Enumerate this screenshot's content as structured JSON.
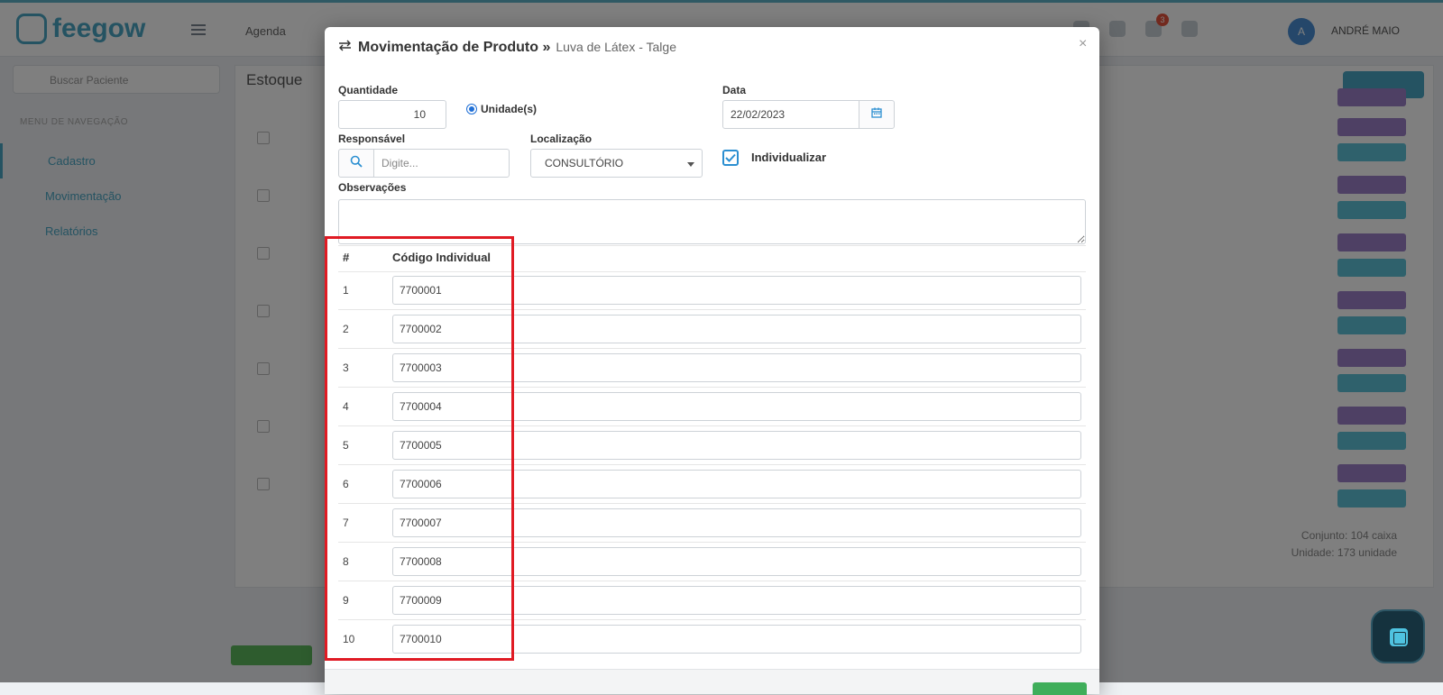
{
  "app": {
    "logo_text": "feegow",
    "nav_agenda": "Agenda",
    "user_initial": "A",
    "user_name": "ANDRÉ MAIO",
    "notif_count": "3",
    "search_placeholder": "Buscar Paciente",
    "page_title": "Estoque",
    "sidebar_section": "MENU DE NAVEGAÇÃO",
    "sidebar_items": [
      "Cadastro",
      "Movimentação",
      "Relatórios"
    ],
    "totals": [
      "Conjunto: 104 caixa",
      "Unidade: 173 unidade"
    ]
  },
  "modal": {
    "title_icon": "transfer-icon",
    "title": "Movimentação de Produto »",
    "subtitle": "Luva de Látex - Talge",
    "close": "×",
    "quantity_label": "Quantidade",
    "quantity_value": "10",
    "unit_option_label": "Unidade(s)",
    "date_label": "Data",
    "date_value": "22/02/2023",
    "responsible_label": "Responsável",
    "responsible_placeholder": "Digite...",
    "location_label": "Localização",
    "location_value": "CONSULTÓRIO",
    "individualize_label": "Individualizar",
    "individualize_checked": true,
    "notes_label": "Observações",
    "notes_value": "",
    "table": {
      "col_num": "#",
      "col_code": "Código Individual",
      "rows": [
        {
          "num": "1",
          "code": "7700001"
        },
        {
          "num": "2",
          "code": "7700002"
        },
        {
          "num": "3",
          "code": "7700003"
        },
        {
          "num": "4",
          "code": "7700004"
        },
        {
          "num": "5",
          "code": "7700005"
        },
        {
          "num": "6",
          "code": "7700006"
        },
        {
          "num": "7",
          "code": "7700007"
        },
        {
          "num": "8",
          "code": "7700008"
        },
        {
          "num": "9",
          "code": "7700009"
        },
        {
          "num": "10",
          "code": "7700010"
        }
      ]
    }
  },
  "colors": {
    "accent": "#4aa6c4",
    "highlight": "#e01b24",
    "checkbox": "#2b8fd1",
    "fab": "#15323e"
  }
}
